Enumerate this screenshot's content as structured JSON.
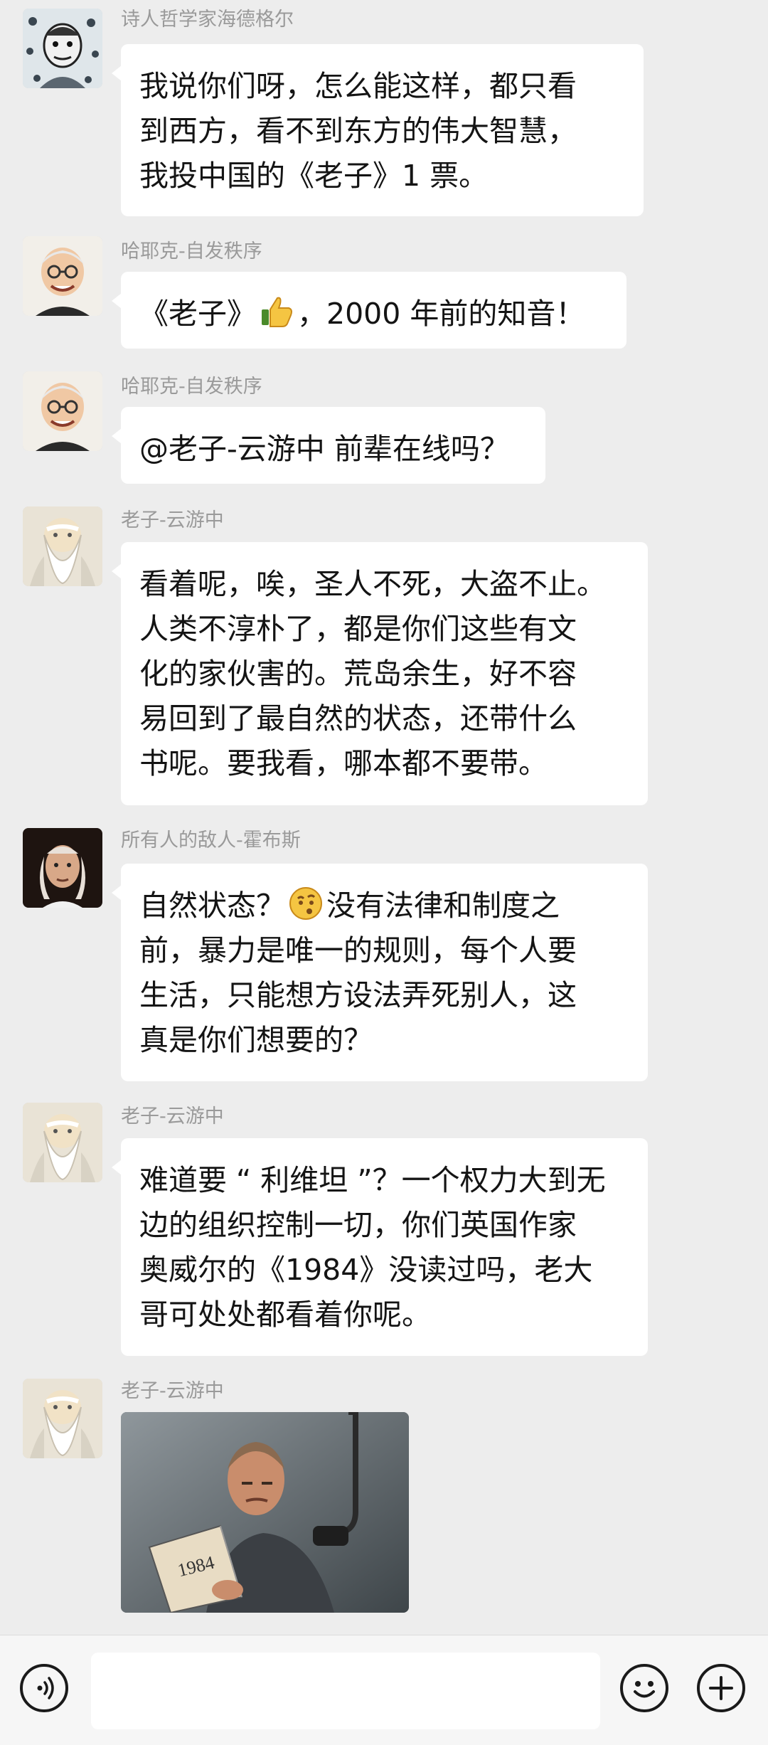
{
  "messages": [
    {
      "sender": "诗人哲学家海德格尔",
      "avatar": "heidegger-avatar",
      "text": "我说你们呀，怎么能这样，都只看\n到西方，看不到东方的伟大智慧，\n我投中国的《老子》1 票。"
    },
    {
      "sender": "哈耶克-自发秩序",
      "avatar": "hayek-avatar",
      "text_before": "《老子》",
      "emoji": "thumbs-up-emoji",
      "text_after": "，2000 年前的知音！"
    },
    {
      "sender": "哈耶克-自发秩序",
      "avatar": "hayek-avatar",
      "text": "@老子-云游中 前辈在线吗？"
    },
    {
      "sender": "老子-云游中",
      "avatar": "laozi-avatar",
      "text": "看着呢，唉，圣人不死，大盗不止。\n人类不淳朴了，都是你们这些有文\n化的家伙害的。荒岛余生，好不容\n易回到了最自然的状态，还带什么\n书呢。要我看，哪本都不要带。"
    },
    {
      "sender": "所有人的敌人-霍布斯",
      "avatar": "hobbes-avatar",
      "text_before": "自然状态？",
      "emoji": "puzzled-face-emoji",
      "text_after": "没有法律和制度之\n前，暴力是唯一的规则，每个人要\n生活，只能想方设法弄死别人，这\n真是你们想要的？"
    },
    {
      "sender": "老子-云游中",
      "avatar": "laozi-avatar",
      "text": "难道要 “ 利维坦 ”？一个权力大到无\n边的组织控制一切，你们英国作家\n奥威尔的《1984》没读过吗，老大\n哥可处处都看着你呢。"
    },
    {
      "sender": "老子-云游中",
      "avatar": "laozi-avatar",
      "image": "man-reading-1984-photo",
      "book_label": "1984"
    }
  ],
  "bottombar": {
    "voice_icon": "voice-input-icon",
    "emoji_icon": "emoji-icon",
    "plus_icon": "add-more-icon",
    "input_value": ""
  },
  "colors": {
    "background": "#ededed",
    "bubble": "#ffffff",
    "sender_text": "#9a9a9a",
    "message_text": "#141414",
    "bottombar": "#f6f6f6"
  }
}
